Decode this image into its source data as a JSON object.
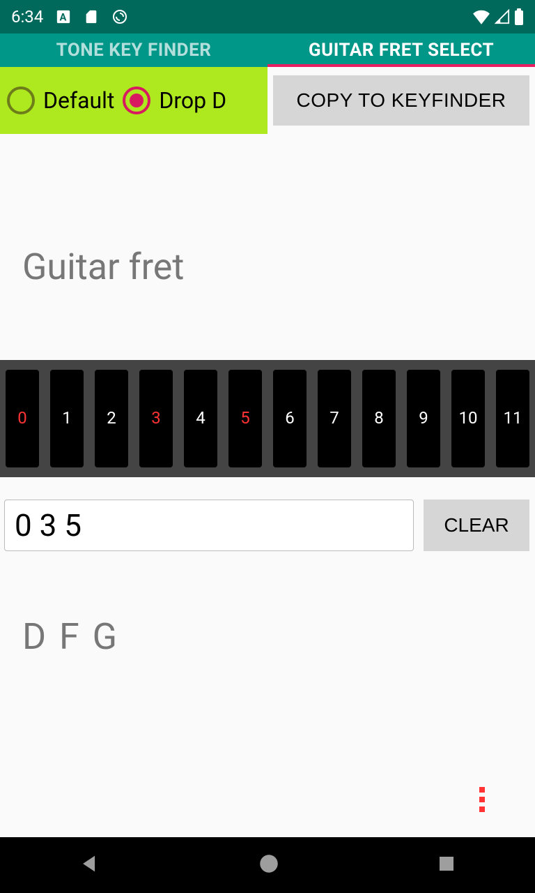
{
  "status": {
    "time": "6:34"
  },
  "tabs": {
    "left": "TONE KEY FINDER",
    "right": "GUITAR FRET SELECT"
  },
  "tuning": {
    "default_label": "Default",
    "dropd_label": "Drop D",
    "selected": "dropd"
  },
  "buttons": {
    "copy": "COPY TO KEYFINDER",
    "clear": "CLEAR"
  },
  "heading": "Guitar fret",
  "frets": [
    {
      "n": "0",
      "sel": true
    },
    {
      "n": "1",
      "sel": false
    },
    {
      "n": "2",
      "sel": false
    },
    {
      "n": "3",
      "sel": true
    },
    {
      "n": "4",
      "sel": false
    },
    {
      "n": "5",
      "sel": true
    },
    {
      "n": "6",
      "sel": false
    },
    {
      "n": "7",
      "sel": false
    },
    {
      "n": "8",
      "sel": false
    },
    {
      "n": "9",
      "sel": false
    },
    {
      "n": "10",
      "sel": false
    },
    {
      "n": "11",
      "sel": false
    }
  ],
  "input_value": "0 3 5",
  "notes": "D F G"
}
